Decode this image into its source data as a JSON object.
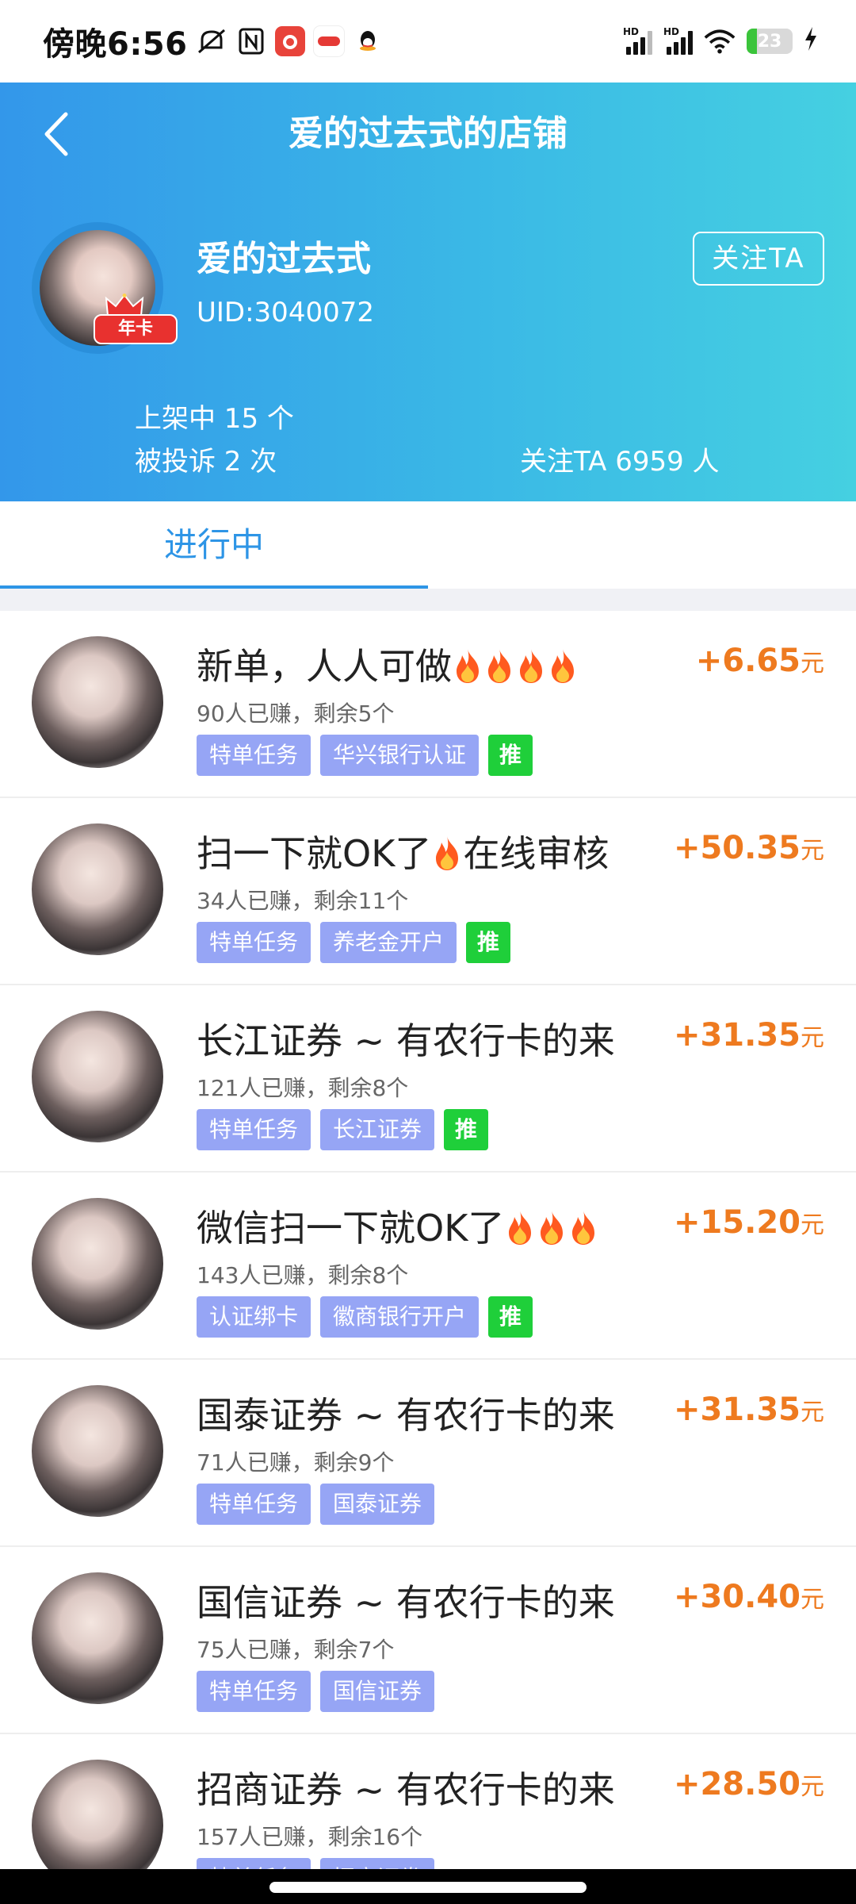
{
  "status_bar": {
    "time": "傍晚6:56",
    "icons": [
      "mute-icon",
      "nfc-icon",
      "app-icon-red",
      "app-icon-mini",
      "qq-icon"
    ],
    "hd1": "HD",
    "hd2": "HD",
    "battery": "23",
    "battery_level": 0.23
  },
  "header": {
    "title": "爱的过去式的店铺",
    "shop_name": "爱的过去式",
    "uid": "UID:3040072",
    "badge": "年卡",
    "follow_label": "关注TA",
    "listed": "上架中 15 个",
    "complaints": "被投诉 2 次",
    "followers": "关注TA 6959 人"
  },
  "tabs": [
    {
      "label": "进行中",
      "active": true
    }
  ],
  "tasks": [
    {
      "title": "新单，人人可做",
      "fires": 4,
      "meta": "90人已赚，剩余5个",
      "tags": [
        "特单任务",
        "华兴银行认证"
      ],
      "rec": "推",
      "reward": "+6.65",
      "unit": "元"
    },
    {
      "title": "扫一下就OK了",
      "fires": 1,
      "suffix": "在线审核",
      "meta": "34人已赚，剩余11个",
      "tags": [
        "特单任务",
        "养老金开户"
      ],
      "rec": "推",
      "reward": "+50.35",
      "unit": "元"
    },
    {
      "title": "长江证券 ~ 有农行卡的来",
      "fires": 0,
      "meta": "121人已赚，剩余8个",
      "tags": [
        "特单任务",
        "长江证券"
      ],
      "rec": "推",
      "reward": "+31.35",
      "unit": "元"
    },
    {
      "title": "微信扫一下就OK了",
      "fires": 3,
      "meta": "143人已赚，剩余8个",
      "tags": [
        "认证绑卡",
        "徽商银行开户"
      ],
      "rec": "推",
      "reward": "+15.20",
      "unit": "元"
    },
    {
      "title": "国泰证券 ~ 有农行卡的来",
      "fires": 0,
      "meta": "71人已赚，剩余9个",
      "tags": [
        "特单任务",
        "国泰证券"
      ],
      "rec": "",
      "reward": "+31.35",
      "unit": "元"
    },
    {
      "title": "国信证券 ~ 有农行卡的来",
      "fires": 0,
      "meta": "75人已赚，剩余7个",
      "tags": [
        "特单任务",
        "国信证券"
      ],
      "rec": "",
      "reward": "+30.40",
      "unit": "元"
    },
    {
      "title": "招商证券 ~ 有农行卡的来",
      "fires": 0,
      "meta": "157人已赚，剩余16个",
      "tags": [
        "特单任务",
        "招商证券"
      ],
      "rec": "",
      "reward": "+28.50",
      "unit": "元"
    }
  ],
  "colors": {
    "accent": "#2e95e6",
    "reward": "#ee7a1f",
    "tag": "#96a5f5",
    "rec": "#1fcf3a"
  }
}
